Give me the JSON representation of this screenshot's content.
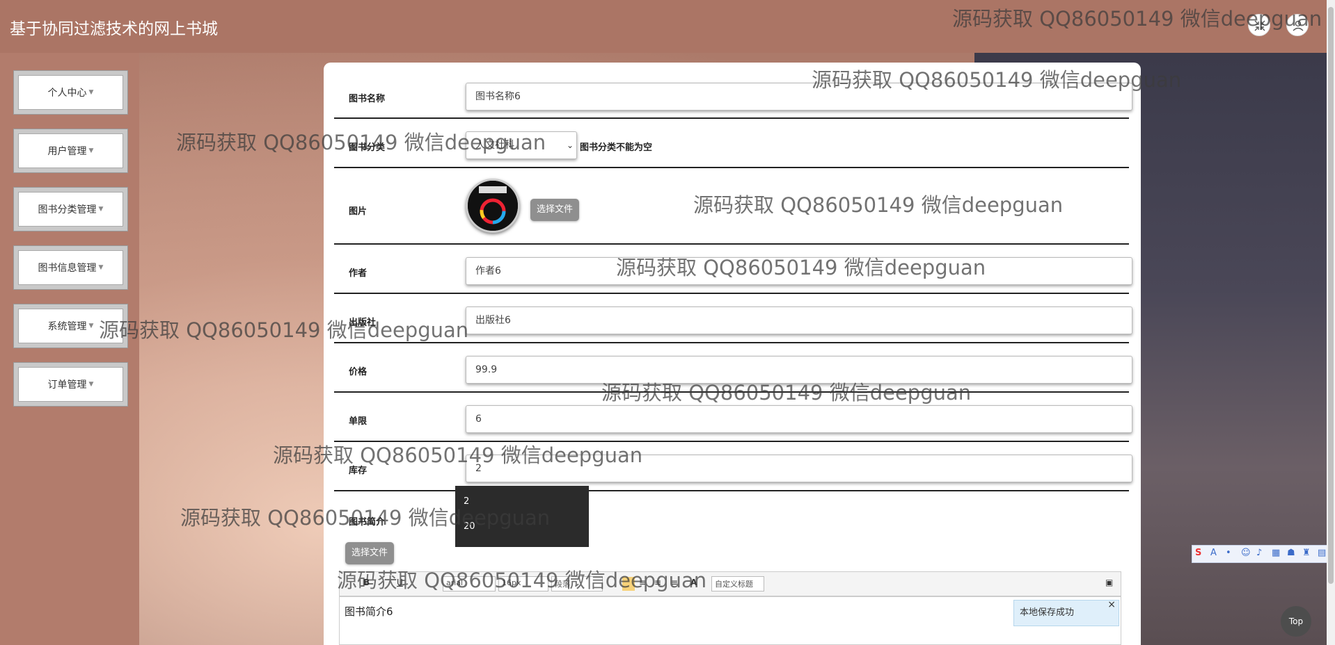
{
  "header": {
    "title": "基于协同过滤技术的网上书城",
    "fullscreen_icon": "fullscreen-exit-icon",
    "user_icon": "user-icon"
  },
  "sidebar": {
    "items": [
      {
        "label": "个人中心"
      },
      {
        "label": "用户管理"
      },
      {
        "label": "图书分类管理"
      },
      {
        "label": "图书信息管理"
      },
      {
        "label": "系统管理"
      },
      {
        "label": "订单管理"
      }
    ]
  },
  "form": {
    "name_label": "图书名称",
    "name_value": "图书名称6",
    "category_label": "图书分类",
    "category_value": "人文社科",
    "category_error": "图书分类不能为空",
    "image_label": "图片",
    "image_button": "选择文件",
    "author_label": "作者",
    "author_value": "作者6",
    "publisher_label": "出版社",
    "publisher_value": "出版社6",
    "price_label": "价格",
    "price_value": "99.9",
    "limit_label": "单限",
    "limit_value": "6",
    "stock_label": "库存",
    "stock_value": "2",
    "intro_label": "图书简介",
    "intro_button": "选择文件"
  },
  "autocomplete": {
    "options": [
      "2",
      "20"
    ]
  },
  "editor": {
    "font_family": "arial",
    "font_size": "16px",
    "paragraph": "段落",
    "custom_title": "自定义标题",
    "content": "图书简介6",
    "toast": "本地保存成功"
  },
  "watermark_text": "源码获取 QQ86050149 微信deepguan",
  "top_button": "Top",
  "colors": {
    "topbar": "#ab7565",
    "sidebar": "#b27c6c",
    "button_gray": "#8f8f8f"
  }
}
